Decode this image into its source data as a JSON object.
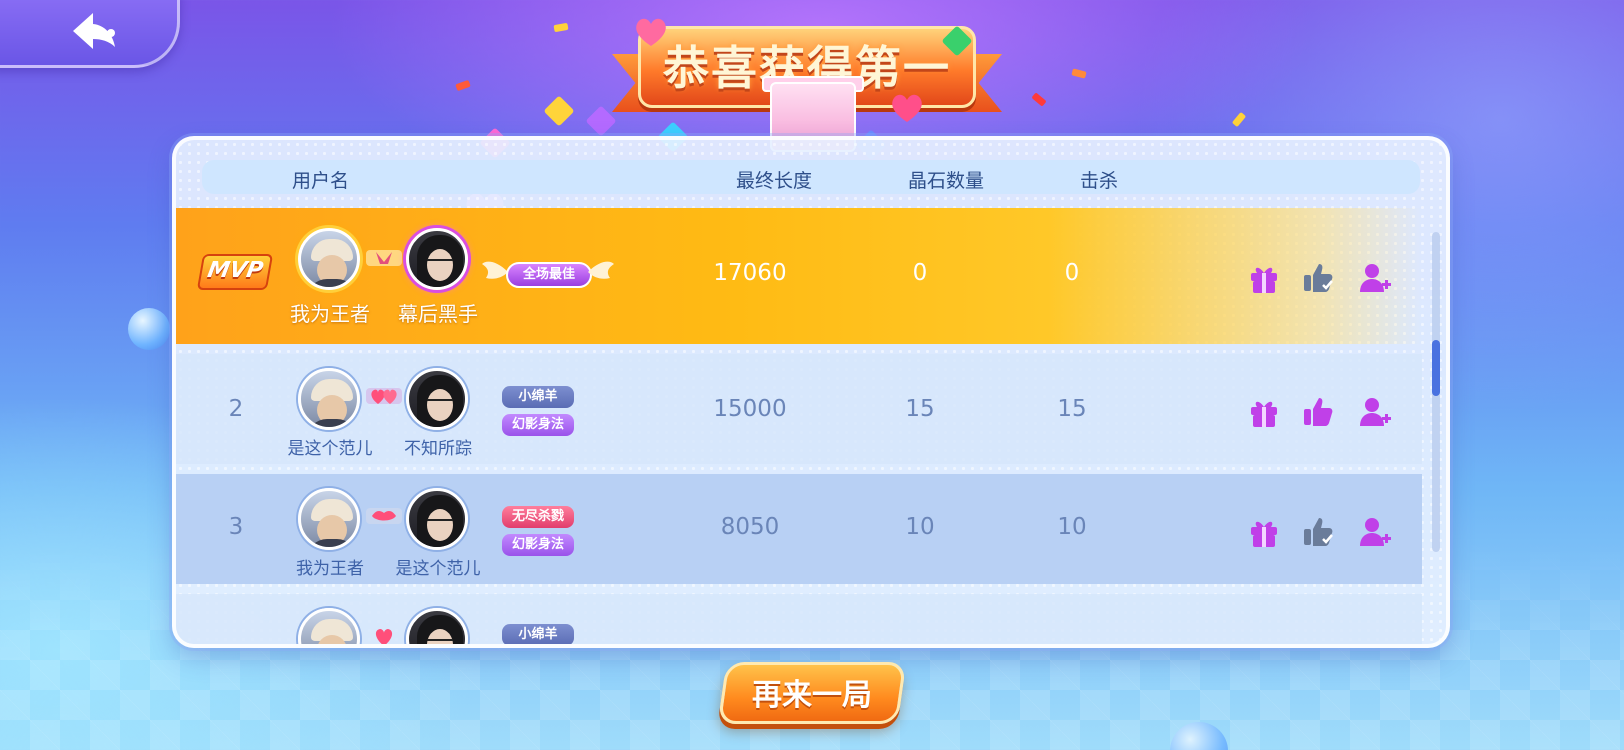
{
  "header": {
    "banner_title": "恭喜获得第一"
  },
  "table": {
    "columns": {
      "username": "用户名",
      "final_length": "最终长度",
      "crystal_count": "晶石数量",
      "kills": "击杀"
    },
    "rows": [
      {
        "rank": "MVP",
        "player1": "我为王者",
        "player2": "幕后黑手",
        "tags": [
          "全场最佳"
        ],
        "final_length": "17060",
        "crystals": "0",
        "kills": "0"
      },
      {
        "rank": "2",
        "player1": "是这个范儿",
        "player2": "不知所踪",
        "tags": [
          "小绵羊",
          "幻影身法"
        ],
        "final_length": "15000",
        "crystals": "15",
        "kills": "15"
      },
      {
        "rank": "3",
        "player1": "我为王者",
        "player2": "是这个范儿",
        "tags": [
          "无尽杀戮",
          "幻影身法"
        ],
        "final_length": "8050",
        "crystals": "10",
        "kills": "10"
      },
      {
        "tags": [
          "小绵羊"
        ]
      }
    ]
  },
  "actions": {
    "icons": [
      "gift-icon",
      "thumbs-up-icon",
      "add-friend-icon"
    ]
  },
  "footer": {
    "play_again_label": "再来一局"
  },
  "colors": {
    "mvp_row": "#ffb81a",
    "action_purple": "#c040e8",
    "thumb_done": "#6a7c9a",
    "scroll_thumb": "#4a72e0",
    "button_orange": "#ff8a1e"
  }
}
